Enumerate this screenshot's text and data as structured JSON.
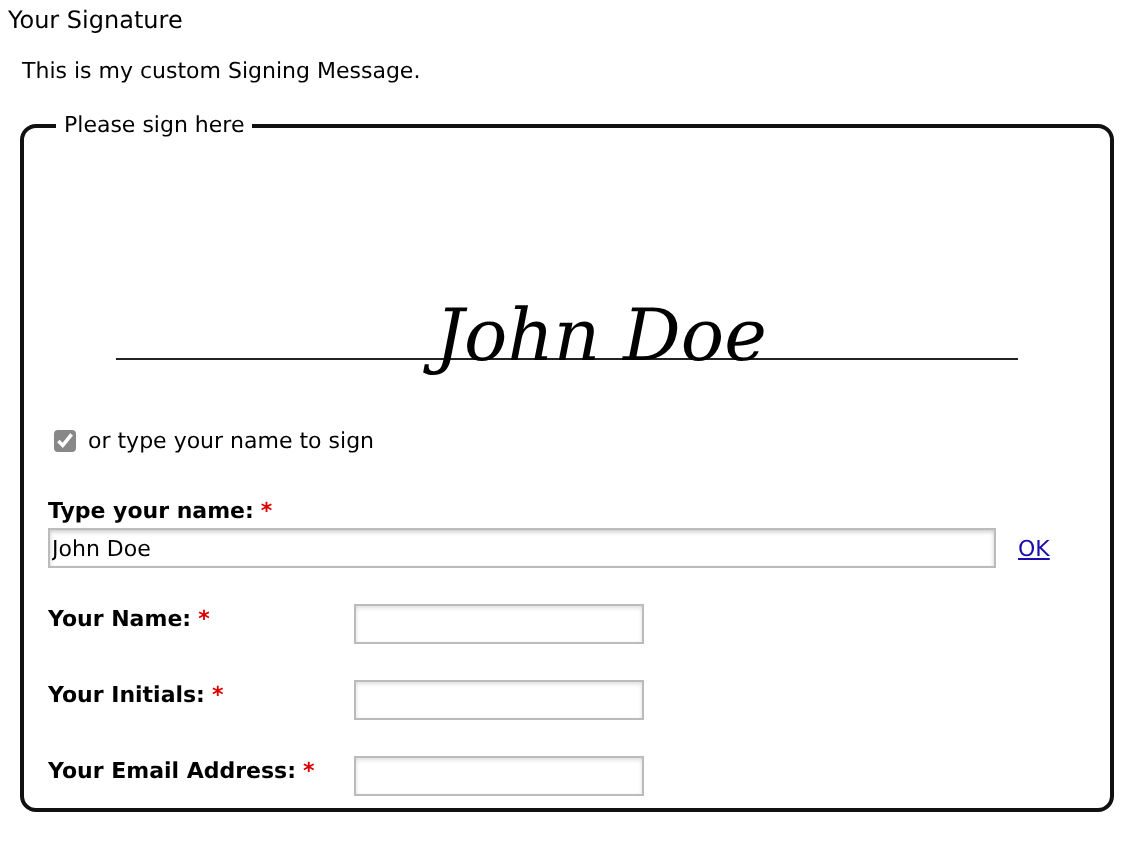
{
  "title": "Your Signature",
  "message": "This is my custom Signing Message.",
  "panel": {
    "legend": "Please sign here",
    "signature": "John Doe",
    "type_option": {
      "label": "or type your name to sign",
      "checked": true
    },
    "typed_name": {
      "label": "Type your name:",
      "required_mark": "*",
      "value": "John Doe",
      "link": "OK"
    },
    "fields": [
      {
        "label": "Your Name:",
        "required_mark": "*"
      },
      {
        "label": "Your Initials:",
        "required_mark": "*"
      },
      {
        "label": "Your Email Address:",
        "required_mark": "*"
      }
    ]
  }
}
